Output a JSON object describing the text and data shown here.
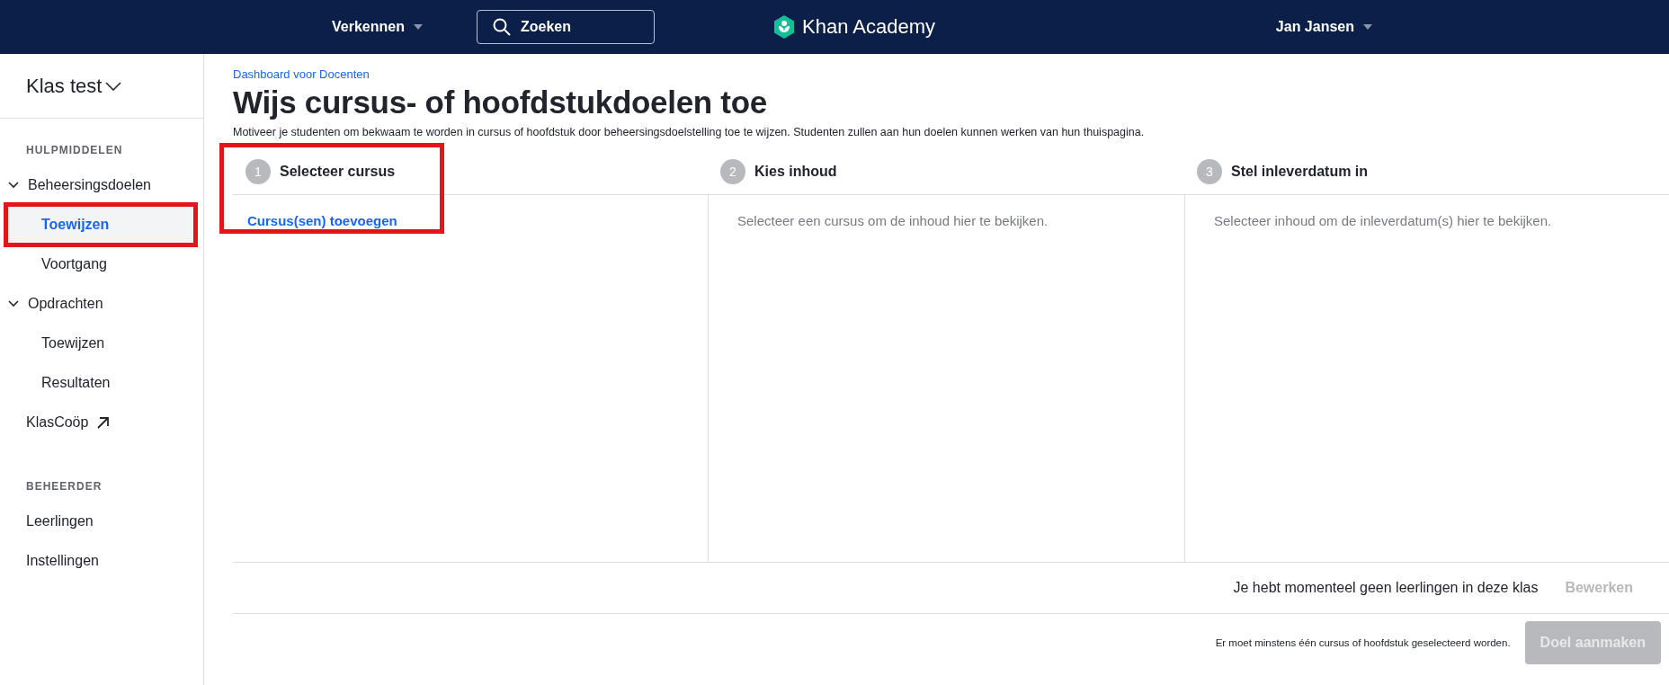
{
  "header": {
    "explore_menu": "Verkennen",
    "search": {
      "placeholder": "Zoeken"
    },
    "logo": "Khan Academy",
    "user_menu": "Jan Jansen"
  },
  "sidebar": {
    "class_switcher": "Klas test",
    "sections": [
      {
        "title": "HULPMIDDELEN",
        "items": [
          {
            "label": "Beheersingsdoelen",
            "kind": "group",
            "expanded": true,
            "children": [
              {
                "label": "Toewijzen",
                "selected": true,
                "highlighted": true
              },
              {
                "label": "Voortgang",
                "selected": false,
                "highlighted": false
              }
            ]
          },
          {
            "label": "Opdrachten",
            "kind": "group",
            "expanded": true,
            "children": [
              {
                "label": "Toewijzen",
                "selected": false,
                "highlighted": false
              },
              {
                "label": "Resultaten",
                "selected": false,
                "highlighted": false
              }
            ]
          },
          {
            "label": "KlasCoöp",
            "kind": "external"
          }
        ]
      },
      {
        "title": "BEHEERDER",
        "items": [
          {
            "label": "Leerlingen",
            "kind": "link"
          },
          {
            "label": "Instellingen",
            "kind": "link"
          }
        ]
      }
    ]
  },
  "main": {
    "breadcrumb": "Dashboard voor Docenten",
    "title": "Wijs cursus- of hoofdstukdoelen toe",
    "description": "Motiveer je studenten om bekwaam te worden in cursus of hoofdstuk door beheersingsdoelstelling toe te wijzen. Studenten zullen aan hun doelen kunnen werken van hun thuispagina.",
    "steps": [
      {
        "number": "1",
        "title": "Selecteer cursus",
        "kind": "action",
        "text": "Cursus(sen) toevoegen",
        "highlighted": true
      },
      {
        "number": "2",
        "title": "Kies inhoud",
        "kind": "empty",
        "text": "Selecteer een cursus om de inhoud hier te bekijken.",
        "highlighted": false
      },
      {
        "number": "3",
        "title": "Stel inleverdatum in",
        "kind": "empty",
        "text": "Selecteer inhoud om de inleverdatum(s) hier te bekijken.",
        "highlighted": false
      }
    ],
    "footer": {
      "students_note": "Je hebt momenteel geen leerlingen in deze klas",
      "edit_button": {
        "label": "Bewerken",
        "disabled": true
      },
      "validation_note": "Er moet minstens één cursus of hoofdstuk geselecteerd worden.",
      "create_button": {
        "label": "Doel aanmaken",
        "disabled": true
      }
    }
  }
}
